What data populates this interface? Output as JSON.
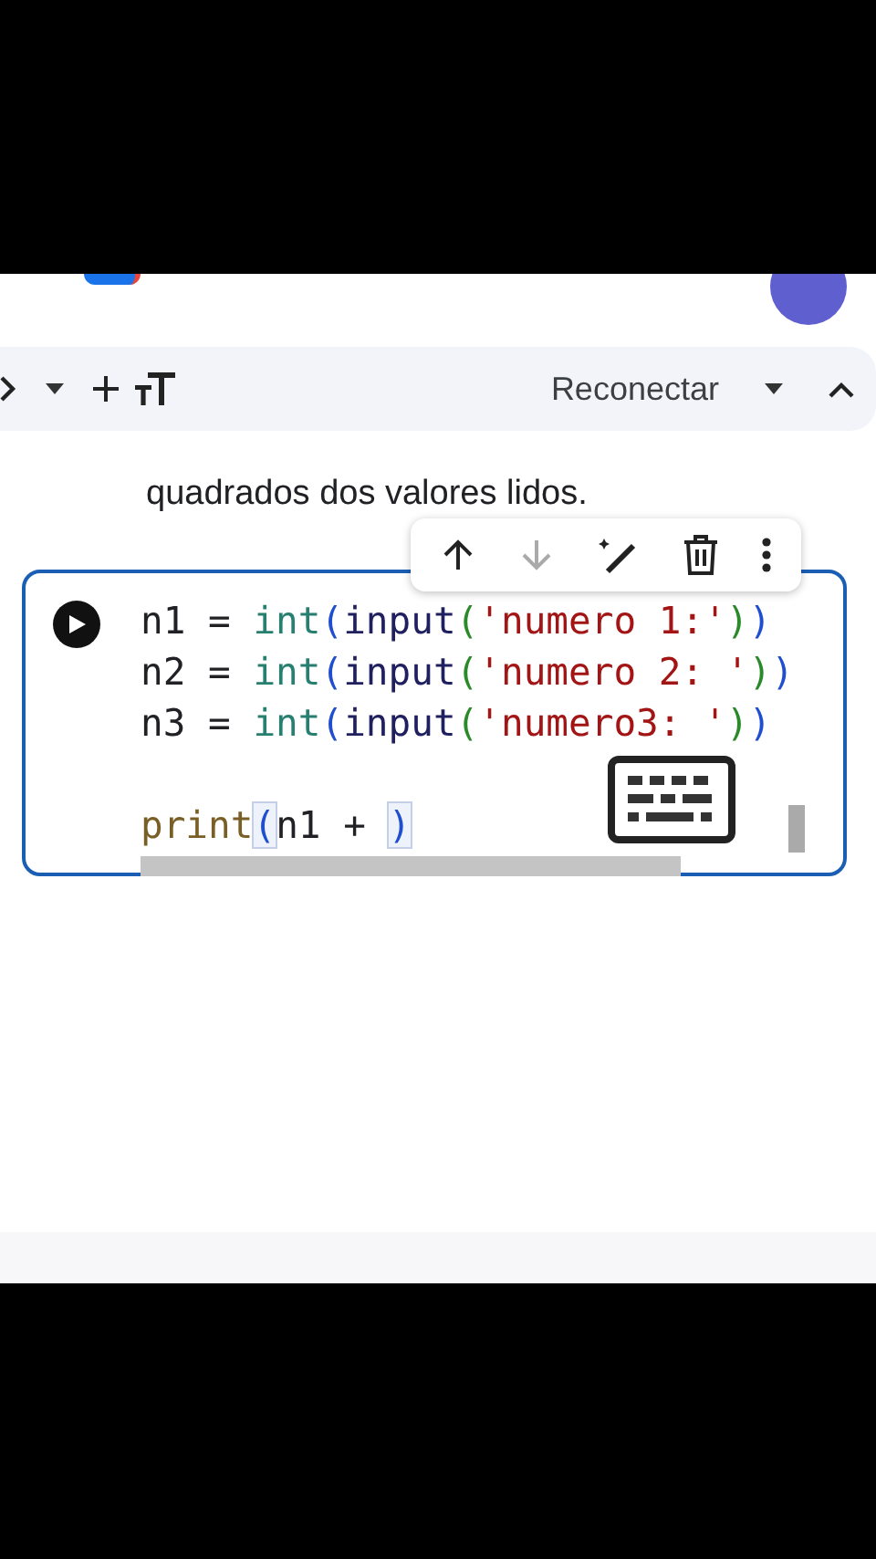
{
  "toolbar": {
    "status": "Reconectar"
  },
  "text_cell": {
    "text": "quadrados dos valores lidos."
  },
  "code_cell": {
    "focused": true,
    "lines": [
      [
        {
          "text": "n1 = ",
          "kind": "plain"
        },
        {
          "text": "int",
          "kind": "builtin"
        },
        {
          "text": "(",
          "kind": "paren1"
        },
        {
          "text": "input",
          "kind": "call"
        },
        {
          "text": "(",
          "kind": "paren2"
        },
        {
          "text": "'numero 1:'",
          "kind": "string"
        },
        {
          "text": ")",
          "kind": "paren2"
        },
        {
          "text": ")",
          "kind": "paren1"
        }
      ],
      [
        {
          "text": "n2 = ",
          "kind": "plain"
        },
        {
          "text": "int",
          "kind": "builtin"
        },
        {
          "text": "(",
          "kind": "paren1"
        },
        {
          "text": "input",
          "kind": "call"
        },
        {
          "text": "(",
          "kind": "paren2"
        },
        {
          "text": "'numero 2: '",
          "kind": "string"
        },
        {
          "text": ")",
          "kind": "paren2"
        },
        {
          "text": ")",
          "kind": "paren1"
        }
      ],
      [
        {
          "text": "n3 = ",
          "kind": "plain"
        },
        {
          "text": "int",
          "kind": "builtin"
        },
        {
          "text": "(",
          "kind": "paren1"
        },
        {
          "text": "input",
          "kind": "call"
        },
        {
          "text": "(",
          "kind": "paren2"
        },
        {
          "text": "'numero3: '",
          "kind": "string"
        },
        {
          "text": ")",
          "kind": "paren2"
        },
        {
          "text": ")",
          "kind": "paren1"
        }
      ],
      {
        "kind": "blank"
      },
      [
        {
          "text": "print",
          "kind": "func"
        },
        {
          "text": "(",
          "kind": "paren1",
          "matched": true
        },
        {
          "text": "n1 + ",
          "kind": "plain"
        },
        {
          "text": ")",
          "kind": "paren1",
          "matched": true
        }
      ]
    ]
  }
}
